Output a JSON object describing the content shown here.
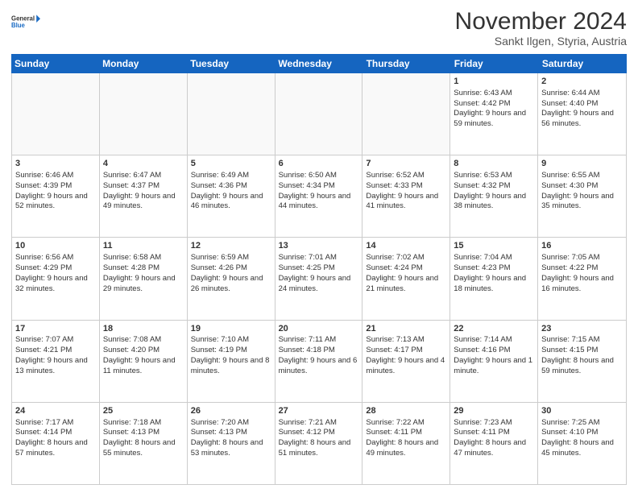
{
  "logo": {
    "general": "General",
    "blue": "Blue"
  },
  "header": {
    "month": "November 2024",
    "location": "Sankt Ilgen, Styria, Austria"
  },
  "weekdays": [
    "Sunday",
    "Monday",
    "Tuesday",
    "Wednesday",
    "Thursday",
    "Friday",
    "Saturday"
  ],
  "rows": [
    [
      {
        "day": "",
        "info": "",
        "empty": true
      },
      {
        "day": "",
        "info": "",
        "empty": true
      },
      {
        "day": "",
        "info": "",
        "empty": true
      },
      {
        "day": "",
        "info": "",
        "empty": true
      },
      {
        "day": "",
        "info": "",
        "empty": true
      },
      {
        "day": "1",
        "info": "Sunrise: 6:43 AM\nSunset: 4:42 PM\nDaylight: 9 hours and 59 minutes.",
        "empty": false
      },
      {
        "day": "2",
        "info": "Sunrise: 6:44 AM\nSunset: 4:40 PM\nDaylight: 9 hours and 56 minutes.",
        "empty": false
      }
    ],
    [
      {
        "day": "3",
        "info": "Sunrise: 6:46 AM\nSunset: 4:39 PM\nDaylight: 9 hours and 52 minutes.",
        "empty": false
      },
      {
        "day": "4",
        "info": "Sunrise: 6:47 AM\nSunset: 4:37 PM\nDaylight: 9 hours and 49 minutes.",
        "empty": false
      },
      {
        "day": "5",
        "info": "Sunrise: 6:49 AM\nSunset: 4:36 PM\nDaylight: 9 hours and 46 minutes.",
        "empty": false
      },
      {
        "day": "6",
        "info": "Sunrise: 6:50 AM\nSunset: 4:34 PM\nDaylight: 9 hours and 44 minutes.",
        "empty": false
      },
      {
        "day": "7",
        "info": "Sunrise: 6:52 AM\nSunset: 4:33 PM\nDaylight: 9 hours and 41 minutes.",
        "empty": false
      },
      {
        "day": "8",
        "info": "Sunrise: 6:53 AM\nSunset: 4:32 PM\nDaylight: 9 hours and 38 minutes.",
        "empty": false
      },
      {
        "day": "9",
        "info": "Sunrise: 6:55 AM\nSunset: 4:30 PM\nDaylight: 9 hours and 35 minutes.",
        "empty": false
      }
    ],
    [
      {
        "day": "10",
        "info": "Sunrise: 6:56 AM\nSunset: 4:29 PM\nDaylight: 9 hours and 32 minutes.",
        "empty": false
      },
      {
        "day": "11",
        "info": "Sunrise: 6:58 AM\nSunset: 4:28 PM\nDaylight: 9 hours and 29 minutes.",
        "empty": false
      },
      {
        "day": "12",
        "info": "Sunrise: 6:59 AM\nSunset: 4:26 PM\nDaylight: 9 hours and 26 minutes.",
        "empty": false
      },
      {
        "day": "13",
        "info": "Sunrise: 7:01 AM\nSunset: 4:25 PM\nDaylight: 9 hours and 24 minutes.",
        "empty": false
      },
      {
        "day": "14",
        "info": "Sunrise: 7:02 AM\nSunset: 4:24 PM\nDaylight: 9 hours and 21 minutes.",
        "empty": false
      },
      {
        "day": "15",
        "info": "Sunrise: 7:04 AM\nSunset: 4:23 PM\nDaylight: 9 hours and 18 minutes.",
        "empty": false
      },
      {
        "day": "16",
        "info": "Sunrise: 7:05 AM\nSunset: 4:22 PM\nDaylight: 9 hours and 16 minutes.",
        "empty": false
      }
    ],
    [
      {
        "day": "17",
        "info": "Sunrise: 7:07 AM\nSunset: 4:21 PM\nDaylight: 9 hours and 13 minutes.",
        "empty": false
      },
      {
        "day": "18",
        "info": "Sunrise: 7:08 AM\nSunset: 4:20 PM\nDaylight: 9 hours and 11 minutes.",
        "empty": false
      },
      {
        "day": "19",
        "info": "Sunrise: 7:10 AM\nSunset: 4:19 PM\nDaylight: 9 hours and 8 minutes.",
        "empty": false
      },
      {
        "day": "20",
        "info": "Sunrise: 7:11 AM\nSunset: 4:18 PM\nDaylight: 9 hours and 6 minutes.",
        "empty": false
      },
      {
        "day": "21",
        "info": "Sunrise: 7:13 AM\nSunset: 4:17 PM\nDaylight: 9 hours and 4 minutes.",
        "empty": false
      },
      {
        "day": "22",
        "info": "Sunrise: 7:14 AM\nSunset: 4:16 PM\nDaylight: 9 hours and 1 minute.",
        "empty": false
      },
      {
        "day": "23",
        "info": "Sunrise: 7:15 AM\nSunset: 4:15 PM\nDaylight: 8 hours and 59 minutes.",
        "empty": false
      }
    ],
    [
      {
        "day": "24",
        "info": "Sunrise: 7:17 AM\nSunset: 4:14 PM\nDaylight: 8 hours and 57 minutes.",
        "empty": false
      },
      {
        "day": "25",
        "info": "Sunrise: 7:18 AM\nSunset: 4:13 PM\nDaylight: 8 hours and 55 minutes.",
        "empty": false
      },
      {
        "day": "26",
        "info": "Sunrise: 7:20 AM\nSunset: 4:13 PM\nDaylight: 8 hours and 53 minutes.",
        "empty": false
      },
      {
        "day": "27",
        "info": "Sunrise: 7:21 AM\nSunset: 4:12 PM\nDaylight: 8 hours and 51 minutes.",
        "empty": false
      },
      {
        "day": "28",
        "info": "Sunrise: 7:22 AM\nSunset: 4:11 PM\nDaylight: 8 hours and 49 minutes.",
        "empty": false
      },
      {
        "day": "29",
        "info": "Sunrise: 7:23 AM\nSunset: 4:11 PM\nDaylight: 8 hours and 47 minutes.",
        "empty": false
      },
      {
        "day": "30",
        "info": "Sunrise: 7:25 AM\nSunset: 4:10 PM\nDaylight: 8 hours and 45 minutes.",
        "empty": false
      }
    ]
  ]
}
